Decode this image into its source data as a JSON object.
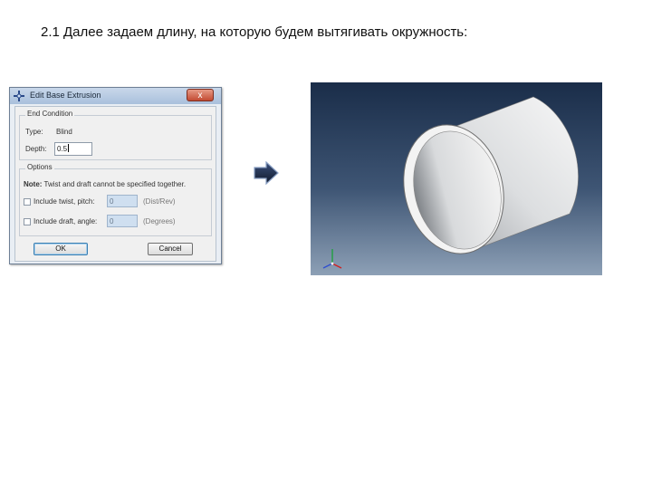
{
  "slide": {
    "title": "2.1 Далее задаем длину, на которую будем вытягивать окружность:"
  },
  "dialog": {
    "title": "Edit Base Extrusion",
    "close_label": "x",
    "end_condition": {
      "group_label": "End Condition",
      "type_label": "Type:",
      "type_value": "Blind",
      "depth_label": "Depth:",
      "depth_value": "0.5"
    },
    "options": {
      "group_label": "Options",
      "note_label": "Note:",
      "note_text": "Twist and draft cannot be specified together.",
      "twist_label": "Include twist, pitch:",
      "twist_value": "0",
      "twist_unit": "(Dist/Rev)",
      "draft_label": "Include draft, angle:",
      "draft_value": "0",
      "draft_unit": "(Degrees)"
    },
    "ok_label": "OK",
    "cancel_label": "Cancel"
  },
  "arrow_icon": "right-arrow-icon",
  "viewport": {
    "background_top": "#1a2d49",
    "background_bottom": "#8da0b6",
    "triad": {
      "x_color": "#d02020",
      "y_color": "#20a040",
      "z_color": "#3050d0"
    }
  }
}
